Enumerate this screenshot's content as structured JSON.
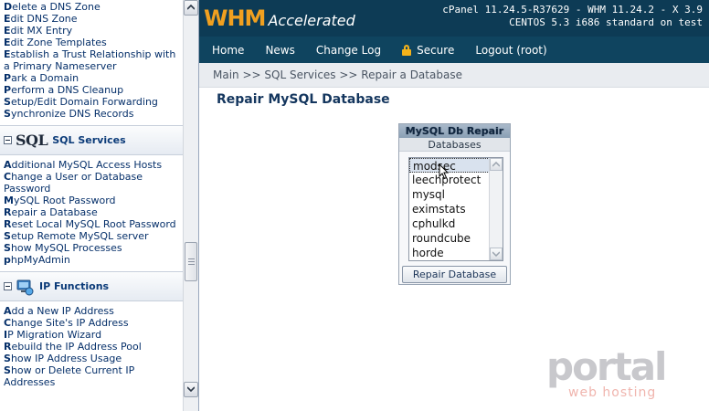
{
  "sidebar": {
    "dns_items": [
      {
        "first": "D",
        "rest": "elete a DNS Zone"
      },
      {
        "first": "E",
        "rest": "dit DNS Zone"
      },
      {
        "first": "E",
        "rest": "dit MX Entry"
      },
      {
        "first": "E",
        "rest": "dit Zone Templates"
      },
      {
        "first": "E",
        "rest": "stablish a Trust Relationship with a Primary Nameserver"
      },
      {
        "first": "P",
        "rest": "ark a Domain"
      },
      {
        "first": "P",
        "rest": "erform a DNS Cleanup"
      },
      {
        "first": "S",
        "rest": "etup/Edit Domain Forwarding"
      },
      {
        "first": "S",
        "rest": "ynchronize DNS Records"
      }
    ],
    "sql_section": {
      "logo": "SQL",
      "title": "SQL Services",
      "icon": "sql-icon"
    },
    "sql_items": [
      {
        "first": "A",
        "rest": "dditional MySQL Access Hosts"
      },
      {
        "first": "C",
        "rest": "hange a User or Database Password"
      },
      {
        "first": "M",
        "rest": "ySQL Root Password"
      },
      {
        "first": "R",
        "rest": "epair a Database"
      },
      {
        "first": "R",
        "rest": "eset Local MySQL Root Password"
      },
      {
        "first": "S",
        "rest": "etup Remote MySQL server"
      },
      {
        "first": "S",
        "rest": "how MySQL Processes"
      },
      {
        "first": "p",
        "rest": "hpMyAdmin"
      }
    ],
    "ip_section": {
      "title": "IP Functions",
      "icon": "ip-network-icon"
    },
    "ip_items": [
      {
        "first": "A",
        "rest": "dd a New IP Address"
      },
      {
        "first": "C",
        "rest": "hange Site's IP Address"
      },
      {
        "first": "I",
        "rest": "P Migration Wizard"
      },
      {
        "first": "R",
        "rest": "ebuild the IP Address Pool"
      },
      {
        "first": "S",
        "rest": "how IP Address Usage"
      },
      {
        "first": "S",
        "rest": "how or Delete Current IP Addresses"
      }
    ]
  },
  "header": {
    "logo_whm": "WHM",
    "logo_accelerated": "Accelerated",
    "version_line1": "cPanel 11.24.5-R37629 - WHM 11.24.2 - X 3.9",
    "version_line2": "CENTOS 5.3 i686 standard on test"
  },
  "menu": {
    "home": "Home",
    "news": "News",
    "changelog": "Change Log",
    "secure": "Secure",
    "logout": "Logout (root)"
  },
  "breadcrumb": "Main >> SQL Services >> Repair a Database",
  "page_title": "Repair MySQL Database",
  "repair_box": {
    "title": "MySQL Db Repair",
    "subtitle": "Databases",
    "databases": [
      "modsec",
      "leechprotect",
      "mysql",
      "eximstats",
      "cphulkd",
      "roundcube",
      "horde"
    ],
    "selected": "modsec",
    "button_label": "Repair Database"
  },
  "watermark": {
    "brand": "portal",
    "sub": "web hosting"
  },
  "colors": {
    "header_bg": "#0d3b55",
    "menubar_bg": "#0f445f",
    "logo_accent": "#f0a020",
    "link": "#06306a"
  }
}
